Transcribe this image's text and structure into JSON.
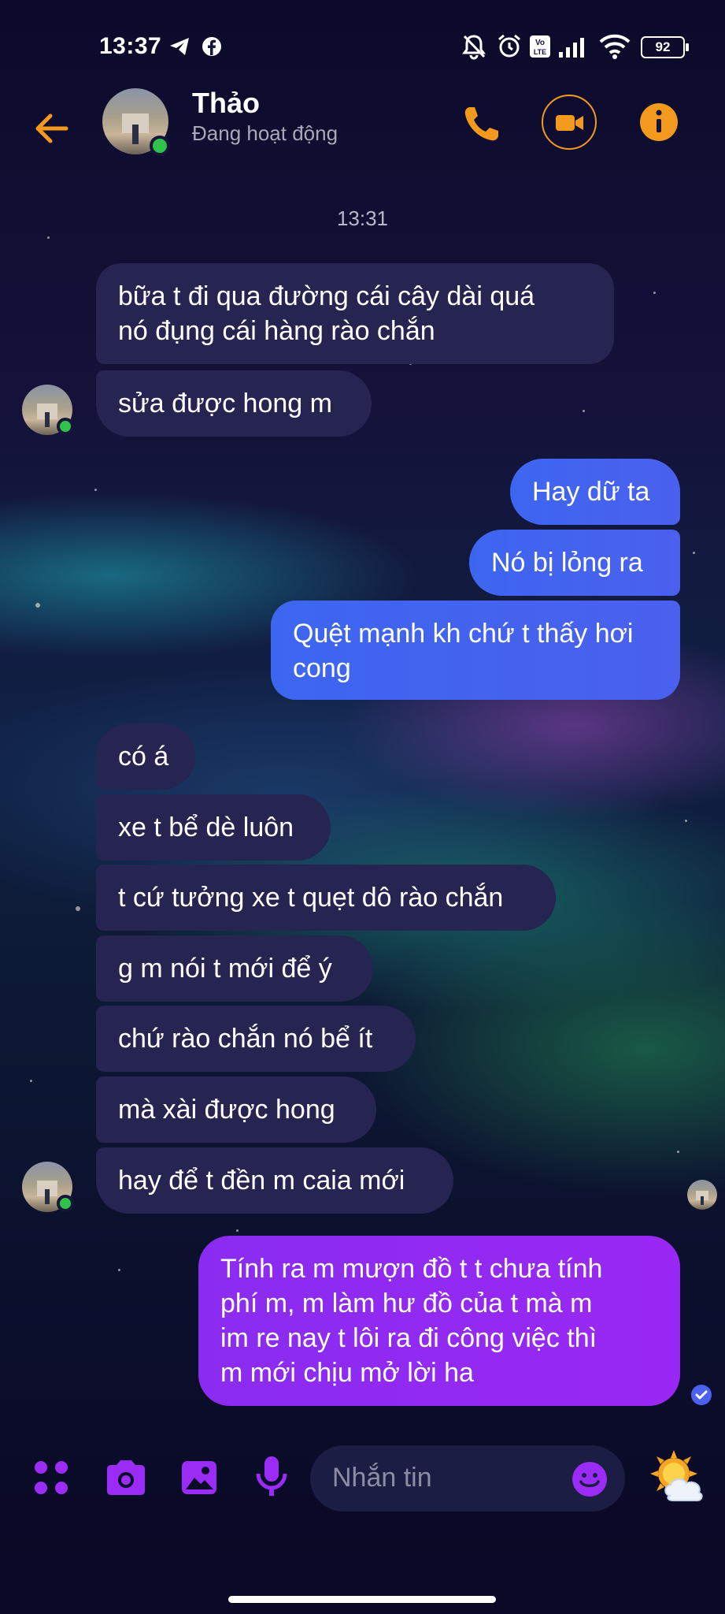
{
  "status_bar": {
    "time": "13:37",
    "icons": [
      "telegram-icon",
      "facebook-icon",
      "mute-icon",
      "alarm-icon",
      "volte-icon",
      "signal-icon",
      "wifi-icon"
    ],
    "battery": "92"
  },
  "header": {
    "name": "Thảo",
    "status": "Đang hoạt động",
    "actions": [
      "back-arrow-icon",
      "phone-icon",
      "video-icon",
      "info-icon"
    ]
  },
  "conversation": {
    "timestamp": "13:31",
    "messages": [
      {
        "side": "in",
        "lines": [
          "bữa t đi qua đường cái cây dài quá",
          "nó đụng cái hàng rào chắn"
        ]
      },
      {
        "side": "in",
        "lines": [
          "sửa được hong m"
        ]
      },
      {
        "side": "out",
        "lines": [
          "Hay dữ ta"
        ]
      },
      {
        "side": "out",
        "lines": [
          "Nó bị lỏng ra"
        ]
      },
      {
        "side": "out",
        "lines": [
          "Quệt mạnh kh chứ t thấy hơi",
          "cong"
        ]
      },
      {
        "side": "in",
        "lines": [
          "có á"
        ]
      },
      {
        "side": "in",
        "lines": [
          "xe t bể dè luôn"
        ]
      },
      {
        "side": "in",
        "lines": [
          "t cứ tưởng xe t quẹt dô rào chắn"
        ]
      },
      {
        "side": "in",
        "lines": [
          "g m nói t mới để ý"
        ]
      },
      {
        "side": "in",
        "lines": [
          "chứ rào chắn nó bể ít"
        ]
      },
      {
        "side": "in",
        "lines": [
          "mà xài được hong"
        ]
      },
      {
        "side": "in",
        "lines": [
          "hay để t đền m caia mới"
        ]
      },
      {
        "side": "out",
        "lines": [
          "Tính ra m mượn đồ t t chưa tính",
          "phí m, m làm hư đồ của t mà m",
          "im re nay t lôi ra đi công việc thì",
          "m mới chịu mở lời ha"
        ]
      }
    ]
  },
  "composer": {
    "placeholder": "Nhắn tin",
    "icons": [
      "apps-icon",
      "camera-icon",
      "gallery-icon",
      "microphone-icon",
      "emoji-icon",
      "weather-sticker-icon"
    ]
  },
  "colors": {
    "accent": "#f39a1e",
    "incoming_bubble": "#262450",
    "outgoing_bubble": "#4a62ee",
    "outgoing_last_bubble": "#9a28f4",
    "composer_icons": "#9b2cf5",
    "online": "#31c24d"
  }
}
